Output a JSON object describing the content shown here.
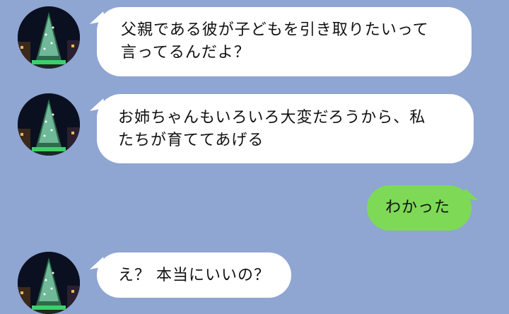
{
  "messages": [
    {
      "sender": "contact",
      "avatar": "christmas-tree-photo",
      "lines": [
        "父親である彼が子どもを引き取りたいって",
        "言ってるんだよ？"
      ]
    },
    {
      "sender": "contact",
      "avatar": "christmas-tree-photo",
      "lines": [
        "お姉ちゃんもいろいろ大変だろうから、私",
        "たちが育ててあげる"
      ]
    },
    {
      "sender": "me",
      "lines": [
        "わかった"
      ]
    },
    {
      "sender": "contact",
      "avatar": "christmas-tree-photo",
      "lines": [
        "え？ 本当にいいの？"
      ]
    }
  ],
  "colors": {
    "background": "#8fa5d2",
    "incoming_bubble": "#ffffff",
    "outgoing_bubble": "#7ed957"
  }
}
